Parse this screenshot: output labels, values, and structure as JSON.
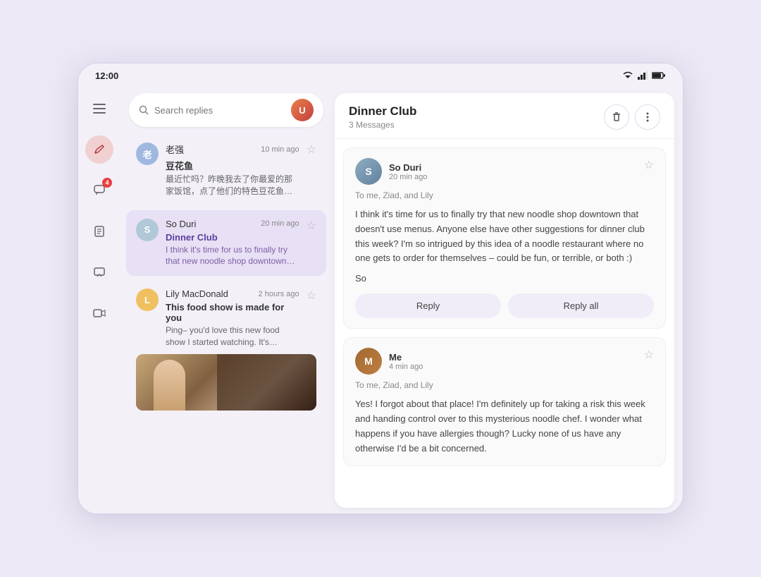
{
  "statusBar": {
    "time": "12:00"
  },
  "sidebar": {
    "items": [
      {
        "name": "menu",
        "icon": "☰",
        "active": false,
        "badge": null
      },
      {
        "name": "compose",
        "icon": "✏",
        "active": true,
        "badge": null
      },
      {
        "name": "chat",
        "icon": "💬",
        "active": false,
        "badge": "4"
      },
      {
        "name": "notes",
        "icon": "☰",
        "active": false,
        "badge": null
      },
      {
        "name": "message",
        "icon": "◻",
        "active": false,
        "badge": null
      },
      {
        "name": "video",
        "icon": "▶",
        "active": false,
        "badge": null
      }
    ]
  },
  "searchBar": {
    "placeholder": "Search replies"
  },
  "messages": [
    {
      "id": "msg1",
      "sender": "老强",
      "avatar": "老",
      "avatarClass": "avatar-laoqiang",
      "time": "10 min ago",
      "subject": "豆花鱼",
      "preview": "最近忙吗？昨晚我去了你最爱的那家饭馆，点了他们的特色豆花鱼，吃着吃着就想你了。",
      "active": false,
      "hasThumbnail": false
    },
    {
      "id": "msg2",
      "sender": "So Duri",
      "avatar": "S",
      "avatarClass": "avatar-so-duri",
      "time": "20 min ago",
      "subject": "Dinner Club",
      "preview": "I think it's time for us to finally try that new noodle shop downtown that doesn't use menus. Anyone...",
      "active": true,
      "hasThumbnail": false
    },
    {
      "id": "msg3",
      "sender": "Lily MacDonald",
      "avatar": "L",
      "avatarClass": "avatar-lily",
      "time": "2 hours ago",
      "subject": "This food show is made for you",
      "preview": "Ping– you'd love this new food show I started watching. It's produced by a Thai drummer who...",
      "active": false,
      "hasThumbnail": true
    }
  ],
  "thread": {
    "title": "Dinner Club",
    "messageCount": "3 Messages",
    "emails": [
      {
        "id": "email1",
        "sender": "So Duri",
        "avatar": "S",
        "avatarClass": "avatar-so-duri-m",
        "time": "20 min ago",
        "to": "To me, Ziad, and Lily",
        "body": "I think it's time for us to finally try that new noodle shop downtown that doesn't use menus. Anyone else have other suggestions for dinner club this week? I'm so intrigued by this idea of a noodle restaurant where no one gets to order for themselves – could be fun, or terrible, or both :)",
        "signature": "So",
        "hasReplyButtons": true
      },
      {
        "id": "email2",
        "sender": "Me",
        "avatar": "M",
        "avatarClass": "avatar-me-m",
        "time": "4 min ago",
        "to": "To me, Ziad, and Lily",
        "body": "Yes! I forgot about that place! I'm definitely up for taking a risk this week and handing control over to this mysterious noodle chef. I wonder what happens if you have allergies though? Lucky none of us have any otherwise I'd be a bit concerned.",
        "signature": "",
        "hasReplyButtons": false
      }
    ],
    "replyLabel": "Reply",
    "replyAllLabel": "Reply all"
  }
}
